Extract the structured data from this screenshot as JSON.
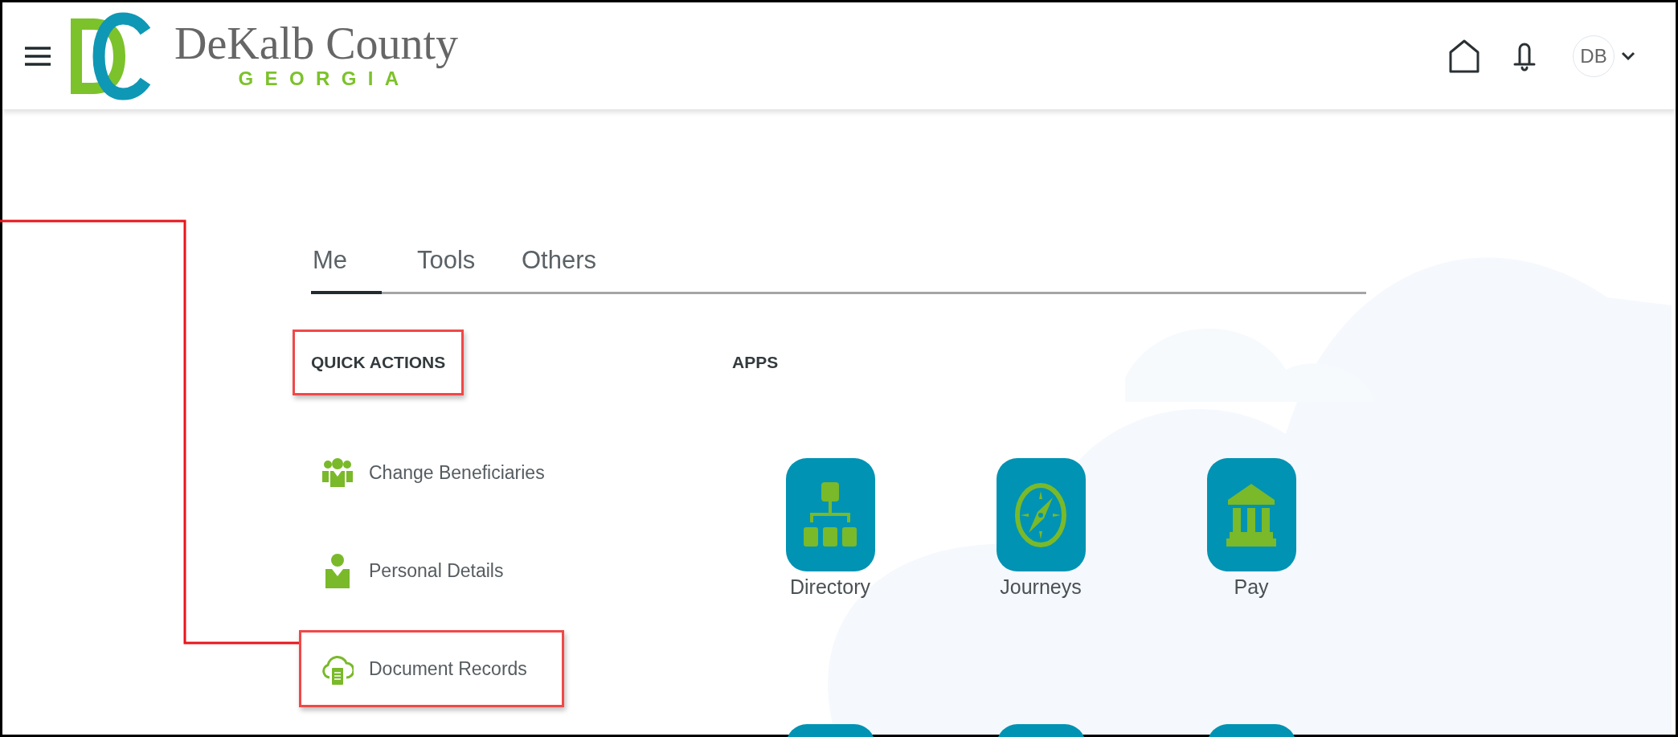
{
  "header": {
    "brand": {
      "name": "DeKalb County",
      "region": "GEORGIA"
    },
    "avatar": {
      "initials": "DB"
    }
  },
  "tabs": [
    {
      "label": "Me",
      "selected": true
    },
    {
      "label": "Tools",
      "selected": false
    },
    {
      "label": "Others",
      "selected": false
    }
  ],
  "quick_actions": {
    "heading": "QUICK ACTIONS",
    "highlighted": true,
    "items": [
      {
        "kind": "group",
        "label": "Change Beneficiaries",
        "highlighted": false
      },
      {
        "kind": "person",
        "label": "Personal Details",
        "highlighted": false
      },
      {
        "kind": "cloud",
        "label": "Document Records",
        "highlighted": true
      }
    ]
  },
  "apps": {
    "heading": "APPS",
    "tiles": [
      {
        "kind": "directory",
        "label": "Directory"
      },
      {
        "kind": "compass",
        "label": "Journeys"
      },
      {
        "kind": "bank",
        "label": "Pay"
      },
      {
        "kind": "blank"
      },
      {
        "kind": "blank"
      },
      {
        "kind": "blank"
      }
    ]
  }
}
